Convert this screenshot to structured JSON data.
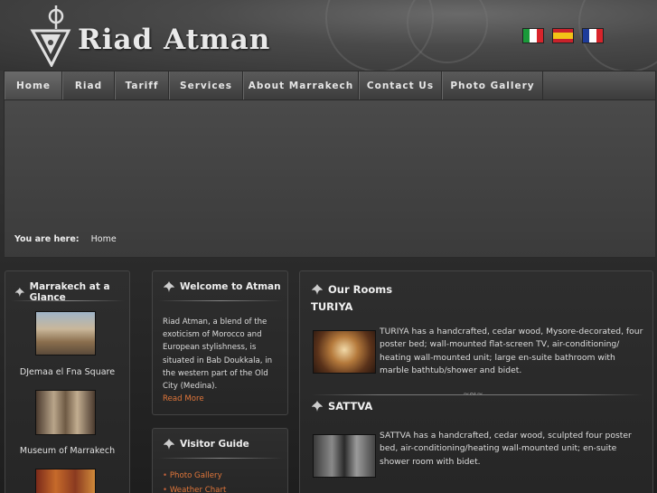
{
  "header": {
    "logo_text": "Riad Atman",
    "flags": [
      {
        "name": "italian-flag",
        "colors": [
          "#1a9a3a",
          "#ffffff",
          "#d8242b"
        ]
      },
      {
        "name": "spanish-flag",
        "colors": [
          "#c8222b",
          "#f3c316",
          "#c8222b"
        ]
      },
      {
        "name": "french-flag",
        "colors": [
          "#1e3c9a",
          "#ffffff",
          "#d8242b"
        ]
      }
    ]
  },
  "nav": {
    "items": [
      "Home",
      "Riad",
      "Tariff",
      "Services",
      "About Marrakech",
      "Contact Us",
      "Photo Gallery"
    ],
    "active": "Home"
  },
  "breadcrumb": {
    "label": "You are here:",
    "current": "Home"
  },
  "glance": {
    "title": "Marrakech at a Glance",
    "items": [
      "DJemaa el Fna Square",
      "Museum of Marrakech"
    ]
  },
  "welcome": {
    "title": "Welcome to Atman",
    "text": "Riad Atman, a blend of the exoticism of Morocco and European stylishness, is situated in Bab Doukkala, in the western part of the Old City (Medina).",
    "read_more": "Read More"
  },
  "visitor": {
    "title": "Visitor Guide",
    "links": [
      "Photo Gallery",
      "Weather Chart"
    ]
  },
  "rooms": {
    "title": "Our Rooms",
    "items": [
      {
        "name": "TURIYA",
        "description": "TURIYA has a handcrafted, cedar wood, Mysore-decorated, four poster bed; wall-mounted flat-screen TV, air-conditioning/ heating wall-mounted unit; large en-suite bathroom with marble bathtub/shower and bidet."
      },
      {
        "name": "SATTVA",
        "description": "SATTVA has a handcrafted, cedar wood, sculpted four poster bed, air-conditioning/heating wall-mounted unit; en-suite shower room with bidet."
      }
    ]
  },
  "colors": {
    "link": "#e0763a",
    "background": "#2a2a2a"
  }
}
